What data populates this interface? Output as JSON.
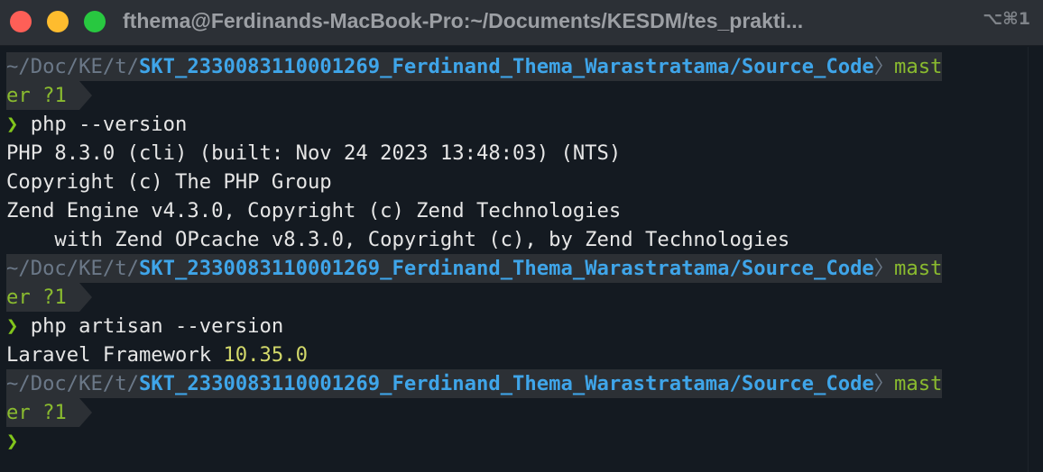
{
  "window": {
    "title": "fthema@Ferdinands-MacBook-Pro:~/Documents/KESDM/tes_prakti...",
    "shortcut": "⌥⌘1"
  },
  "prompt": {
    "path_dim": "~/Doc/KE/t/",
    "path_bold": "SKT_2330083110001269_Ferdinand_Thema_Warastratama/Source_Code",
    "separator": "〉",
    "branch_start": "mast",
    "branch_end": "er ?1",
    "symbol": "❯"
  },
  "commands": [
    {
      "cmd": "php --version",
      "output": [
        "PHP 8.3.0 (cli) (built: Nov 24 2023 13:48:03) (NTS)",
        "Copyright (c) The PHP Group",
        "Zend Engine v4.3.0, Copyright (c) Zend Technologies",
        "    with Zend OPcache v8.3.0, Copyright (c), by Zend Technologies"
      ]
    },
    {
      "cmd": "php artisan --version",
      "output_label": "Laravel Framework ",
      "output_version": "10.35.0"
    }
  ],
  "colors": {
    "background": "#141a21",
    "titlebar": "#2c3036",
    "path_bold": "#3fa5e9",
    "path_dim": "#6b7888",
    "git": "#8abb2f",
    "prompt_symbol": "#82c51c",
    "version_highlight": "#d2d86a"
  }
}
